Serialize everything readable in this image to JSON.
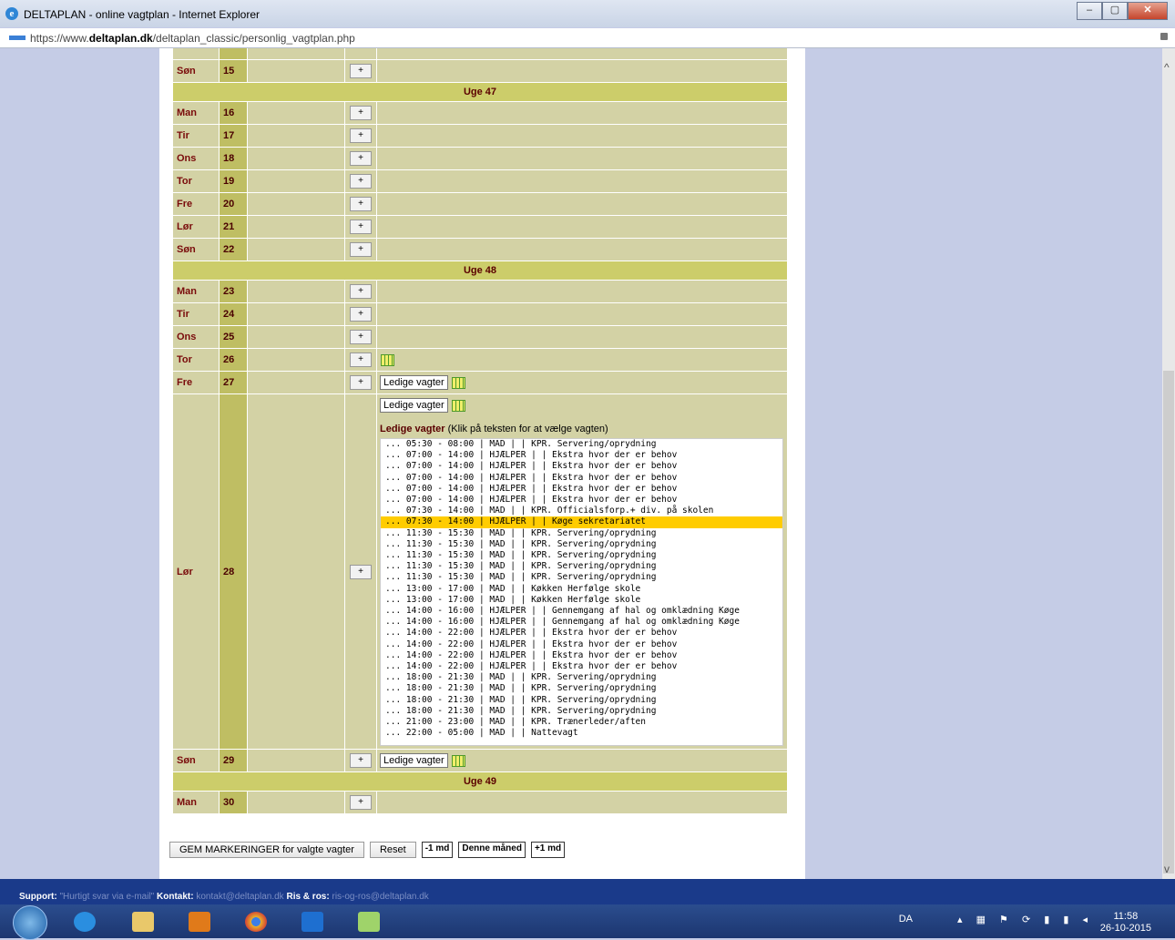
{
  "window": {
    "title": "DELTAPLAN - online vagtplan - Internet Explorer",
    "url_prefix": "https://www.",
    "url_domain": "deltaplan.dk",
    "url_path": "/deltaplan_classic/personlig_vagtplan.php"
  },
  "calendar": {
    "rows": [
      {
        "type": "day",
        "day": "Søn",
        "num": "15"
      },
      {
        "type": "week",
        "label": "Uge 47"
      },
      {
        "type": "day",
        "day": "Man",
        "num": "16"
      },
      {
        "type": "day",
        "day": "Tir",
        "num": "17"
      },
      {
        "type": "day",
        "day": "Ons",
        "num": "18"
      },
      {
        "type": "day",
        "day": "Tor",
        "num": "19"
      },
      {
        "type": "day",
        "day": "Fre",
        "num": "20"
      },
      {
        "type": "day",
        "day": "Lør",
        "num": "21"
      },
      {
        "type": "day",
        "day": "Søn",
        "num": "22"
      },
      {
        "type": "week",
        "label": "Uge 48"
      },
      {
        "type": "day",
        "day": "Man",
        "num": "23"
      },
      {
        "type": "day",
        "day": "Tir",
        "num": "24"
      },
      {
        "type": "day",
        "day": "Ons",
        "num": "25"
      },
      {
        "type": "day",
        "day": "Tor",
        "num": "26",
        "calicon": true
      },
      {
        "type": "day",
        "day": "Fre",
        "num": "27",
        "ledige": true,
        "calicon": true
      },
      {
        "type": "expanded",
        "day": "Lør",
        "num": "28"
      },
      {
        "type": "day",
        "day": "Søn",
        "num": "29",
        "ledige": true,
        "calicon": true
      },
      {
        "type": "week",
        "label": "Uge 49"
      },
      {
        "type": "day",
        "day": "Man",
        "num": "30"
      }
    ],
    "plus_label": "+",
    "ledige_label": "Ledige vagter",
    "list_title": "Ledige vagter",
    "list_hint": "(Klik på teksten for at vælge vagten)",
    "selected_index": 7,
    "shifts": [
      "...  05:30 - 08:00 | MAD |  | KPR. Servering/oprydning",
      "...  07:00 - 14:00 | HJÆLPER |  | Ekstra hvor der er behov",
      "...  07:00 - 14:00 | HJÆLPER |  | Ekstra hvor der er behov",
      "...  07:00 - 14:00 | HJÆLPER |  | Ekstra hvor der er behov",
      "...  07:00 - 14:00 | HJÆLPER |  | Ekstra hvor der er behov",
      "...  07:00 - 14:00 | HJÆLPER |  | Ekstra hvor der er behov",
      "...  07:30 - 14:00 | MAD |  | KPR. Officialsforp.+ div. på skolen",
      "...  07:30 - 14:00 | HJÆLPER |  | Køge sekretariatet",
      "...  11:30 - 15:30 | MAD |  | KPR. Servering/oprydning",
      "...  11:30 - 15:30 | MAD |  | KPR. Servering/oprydning",
      "...  11:30 - 15:30 | MAD |  | KPR. Servering/oprydning",
      "...  11:30 - 15:30 | MAD |  | KPR. Servering/oprydning",
      "...  11:30 - 15:30 | MAD |  | KPR. Servering/oprydning",
      "...  13:00 - 17:00 | MAD |  | Køkken Herfølge skole",
      "...  13:00 - 17:00 | MAD |  | Køkken Herfølge skole",
      "...  14:00 - 16:00 | HJÆLPER |  | Gennemgang af hal og omklædning Køge",
      "...  14:00 - 16:00 | HJÆLPER |  | Gennemgang af hal og omklædning Køge",
      "...  14:00 - 22:00 | HJÆLPER |  | Ekstra hvor der er behov",
      "...  14:00 - 22:00 | HJÆLPER |  | Ekstra hvor der er behov",
      "...  14:00 - 22:00 | HJÆLPER |  | Ekstra hvor der er behov",
      "...  14:00 - 22:00 | HJÆLPER |  | Ekstra hvor der er behov",
      "...  18:00 - 21:30 | MAD |  | KPR. Servering/oprydning",
      "...  18:00 - 21:30 | MAD |  | KPR. Servering/oprydning",
      "...  18:00 - 21:30 | MAD |  | KPR. Servering/oprydning",
      "...  18:00 - 21:30 | MAD |  | KPR. Servering/oprydning",
      "...  21:00 - 23:00 | MAD |  | KPR. Trænerleder/aften",
      "...  22:00 - 05:00 | MAD |  | Nattevagt"
    ]
  },
  "buttons": {
    "save": "GEM MARKERINGER for valgte vagter",
    "reset": "Reset",
    "prev_month": "-1 md",
    "this_month": "Denne måned",
    "next_month": "+1 md"
  },
  "footer": {
    "support_label": "Support:",
    "support_text": "\"Hurtigt svar via e-mail\"",
    "contact_label": "Kontakt:",
    "contact_email": "kontakt@deltaplan.dk",
    "ris_label": "Ris & ros:",
    "ris_email": "ris-og-ros@deltaplan.dk"
  },
  "taskbar": {
    "lang": "DA",
    "time": "11:58",
    "date": "26-10-2015"
  }
}
